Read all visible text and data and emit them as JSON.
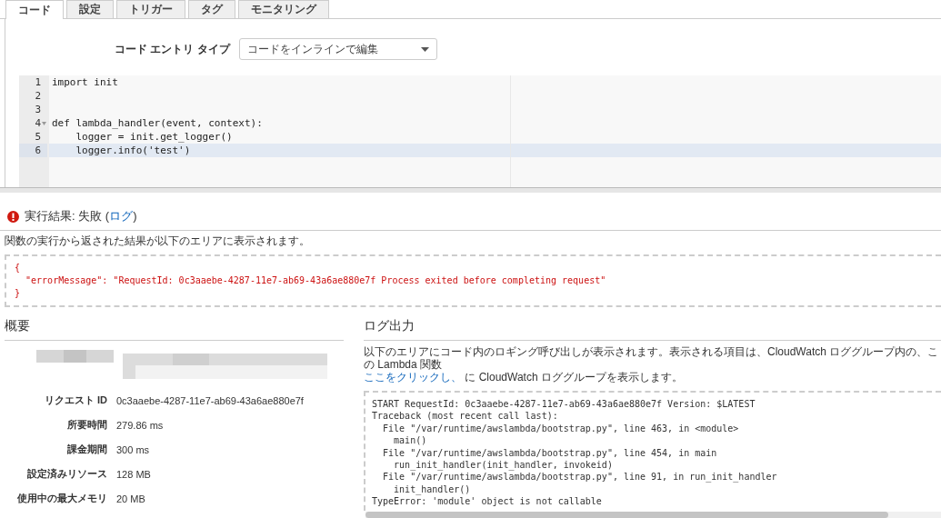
{
  "tabs": [
    {
      "label": "コード",
      "selected": true
    },
    {
      "label": "設定",
      "selected": false
    },
    {
      "label": "トリガー",
      "selected": false
    },
    {
      "label": "タグ",
      "selected": false
    },
    {
      "label": "モニタリング",
      "selected": false
    }
  ],
  "entry_type": {
    "label": "コード エントリ タイプ",
    "value": "コードをインラインで編集"
  },
  "editor": {
    "lines": [
      {
        "number": "1",
        "text": "import init",
        "active": false,
        "foldable": false
      },
      {
        "number": "2",
        "active": false,
        "foldable": false
      },
      {
        "number": "3",
        "active": false,
        "foldable": false
      },
      {
        "number": "4",
        "text": "def lambda_handler(event, context):",
        "active": false,
        "foldable": true
      },
      {
        "number": "5",
        "text": "    logger = init.get_logger()",
        "active": false,
        "foldable": false
      },
      {
        "number": "6",
        "text": "    logger.info('test')",
        "active": true,
        "foldable": false
      }
    ]
  },
  "result": {
    "title": "実行結果: 失敗 (",
    "link": "ログ",
    "title_end": ")",
    "description": "関数の実行から返された結果が以下のエリアに表示されます。",
    "output": [
      "{",
      "  \"errorMessage\": \"RequestId: 0c3aaebe-4287-11e7-ab69-43a6ae880e7f Process exited before completing request\"",
      "}"
    ]
  },
  "summary": {
    "title": "概要",
    "rows": [
      {
        "label": "リクエスト ID",
        "value": "0c3aaebe-4287-11e7-ab69-43a6ae880e7f"
      },
      {
        "label": "所要時間",
        "value": "279.86 ms"
      },
      {
        "label": "課金期間",
        "value": "300 ms"
      },
      {
        "label": "設定済みリソース",
        "value": "128 MB"
      },
      {
        "label": "使用中の最大メモリ",
        "value": "20 MB"
      }
    ]
  },
  "log": {
    "title": "ログ出力",
    "description": "以下のエリアにコード内のロギング呼び出しが表示されます。表示される項目は、CloudWatch ロググループ内の、この Lambda 関数",
    "link": "ここをクリックし、",
    "link_rest": " に CloudWatch ロググループを表示します。",
    "lines": [
      "START RequestId: 0c3aaebe-4287-11e7-ab69-43a6ae880e7f Version: $LATEST",
      "Traceback (most recent call last):",
      "  File \"/var/runtime/awslambda/bootstrap.py\", line 463, in <module>",
      "    main()",
      "  File \"/var/runtime/awslambda/bootstrap.py\", line 454, in main",
      "    run_init_handler(init_handler, invokeid)",
      "  File \"/var/runtime/awslambda/bootstrap.py\", line 91, in run_init_handler",
      "    init_handler()",
      "TypeError: 'module' object is not callable"
    ]
  }
}
